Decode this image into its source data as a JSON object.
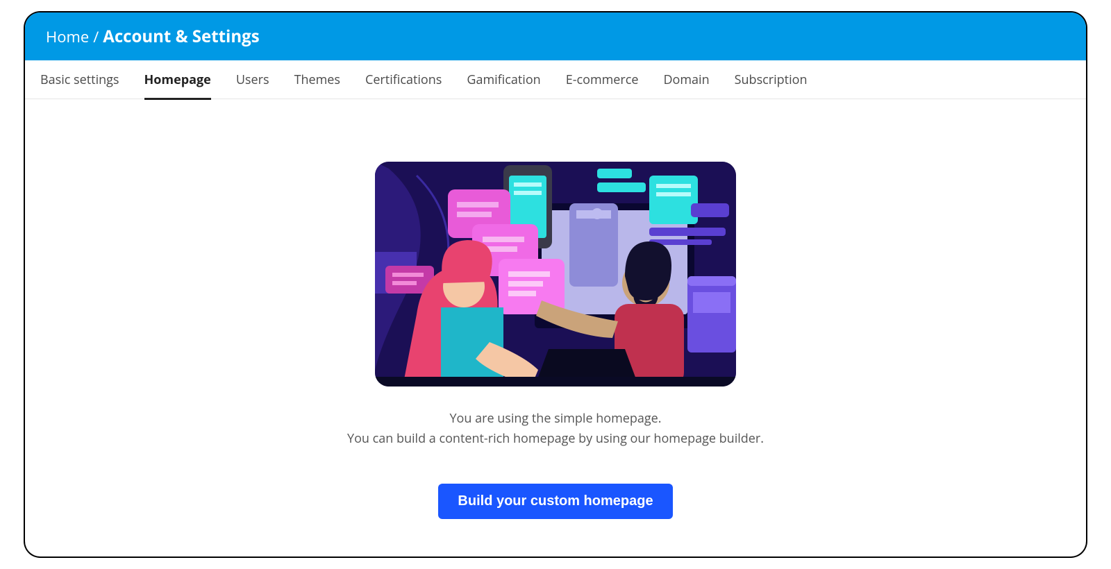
{
  "breadcrumb": {
    "home": "Home",
    "separator": "/",
    "current": "Account & Settings"
  },
  "tabs": [
    {
      "label": "Basic settings",
      "active": false
    },
    {
      "label": "Homepage",
      "active": true
    },
    {
      "label": "Users",
      "active": false
    },
    {
      "label": "Themes",
      "active": false
    },
    {
      "label": "Certifications",
      "active": false
    },
    {
      "label": "Gamification",
      "active": false
    },
    {
      "label": "E-commerce",
      "active": false
    },
    {
      "label": "Domain",
      "active": false
    },
    {
      "label": "Subscription",
      "active": false
    }
  ],
  "main": {
    "illustration_alt": "People collaborating at a computer with chat and document panels",
    "message_line1": "You are using the simple homepage.",
    "message_line2": "You can build a content-rich homepage by using our homepage builder.",
    "cta_label": "Build your custom homepage"
  },
  "colors": {
    "header_bg": "#0099e5",
    "cta_bg": "#1a56ff"
  }
}
